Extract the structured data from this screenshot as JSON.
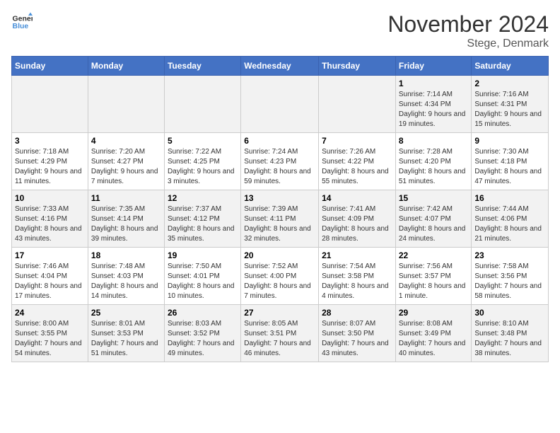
{
  "header": {
    "logo_line1": "General",
    "logo_line2": "Blue",
    "month": "November 2024",
    "location": "Stege, Denmark"
  },
  "weekdays": [
    "Sunday",
    "Monday",
    "Tuesday",
    "Wednesday",
    "Thursday",
    "Friday",
    "Saturday"
  ],
  "weeks": [
    [
      {
        "day": "",
        "info": ""
      },
      {
        "day": "",
        "info": ""
      },
      {
        "day": "",
        "info": ""
      },
      {
        "day": "",
        "info": ""
      },
      {
        "day": "",
        "info": ""
      },
      {
        "day": "1",
        "info": "Sunrise: 7:14 AM\nSunset: 4:34 PM\nDaylight: 9 hours and 19 minutes."
      },
      {
        "day": "2",
        "info": "Sunrise: 7:16 AM\nSunset: 4:31 PM\nDaylight: 9 hours and 15 minutes."
      }
    ],
    [
      {
        "day": "3",
        "info": "Sunrise: 7:18 AM\nSunset: 4:29 PM\nDaylight: 9 hours and 11 minutes."
      },
      {
        "day": "4",
        "info": "Sunrise: 7:20 AM\nSunset: 4:27 PM\nDaylight: 9 hours and 7 minutes."
      },
      {
        "day": "5",
        "info": "Sunrise: 7:22 AM\nSunset: 4:25 PM\nDaylight: 9 hours and 3 minutes."
      },
      {
        "day": "6",
        "info": "Sunrise: 7:24 AM\nSunset: 4:23 PM\nDaylight: 8 hours and 59 minutes."
      },
      {
        "day": "7",
        "info": "Sunrise: 7:26 AM\nSunset: 4:22 PM\nDaylight: 8 hours and 55 minutes."
      },
      {
        "day": "8",
        "info": "Sunrise: 7:28 AM\nSunset: 4:20 PM\nDaylight: 8 hours and 51 minutes."
      },
      {
        "day": "9",
        "info": "Sunrise: 7:30 AM\nSunset: 4:18 PM\nDaylight: 8 hours and 47 minutes."
      }
    ],
    [
      {
        "day": "10",
        "info": "Sunrise: 7:33 AM\nSunset: 4:16 PM\nDaylight: 8 hours and 43 minutes."
      },
      {
        "day": "11",
        "info": "Sunrise: 7:35 AM\nSunset: 4:14 PM\nDaylight: 8 hours and 39 minutes."
      },
      {
        "day": "12",
        "info": "Sunrise: 7:37 AM\nSunset: 4:12 PM\nDaylight: 8 hours and 35 minutes."
      },
      {
        "day": "13",
        "info": "Sunrise: 7:39 AM\nSunset: 4:11 PM\nDaylight: 8 hours and 32 minutes."
      },
      {
        "day": "14",
        "info": "Sunrise: 7:41 AM\nSunset: 4:09 PM\nDaylight: 8 hours and 28 minutes."
      },
      {
        "day": "15",
        "info": "Sunrise: 7:42 AM\nSunset: 4:07 PM\nDaylight: 8 hours and 24 minutes."
      },
      {
        "day": "16",
        "info": "Sunrise: 7:44 AM\nSunset: 4:06 PM\nDaylight: 8 hours and 21 minutes."
      }
    ],
    [
      {
        "day": "17",
        "info": "Sunrise: 7:46 AM\nSunset: 4:04 PM\nDaylight: 8 hours and 17 minutes."
      },
      {
        "day": "18",
        "info": "Sunrise: 7:48 AM\nSunset: 4:03 PM\nDaylight: 8 hours and 14 minutes."
      },
      {
        "day": "19",
        "info": "Sunrise: 7:50 AM\nSunset: 4:01 PM\nDaylight: 8 hours and 10 minutes."
      },
      {
        "day": "20",
        "info": "Sunrise: 7:52 AM\nSunset: 4:00 PM\nDaylight: 8 hours and 7 minutes."
      },
      {
        "day": "21",
        "info": "Sunrise: 7:54 AM\nSunset: 3:58 PM\nDaylight: 8 hours and 4 minutes."
      },
      {
        "day": "22",
        "info": "Sunrise: 7:56 AM\nSunset: 3:57 PM\nDaylight: 8 hours and 1 minute."
      },
      {
        "day": "23",
        "info": "Sunrise: 7:58 AM\nSunset: 3:56 PM\nDaylight: 7 hours and 58 minutes."
      }
    ],
    [
      {
        "day": "24",
        "info": "Sunrise: 8:00 AM\nSunset: 3:55 PM\nDaylight: 7 hours and 54 minutes."
      },
      {
        "day": "25",
        "info": "Sunrise: 8:01 AM\nSunset: 3:53 PM\nDaylight: 7 hours and 51 minutes."
      },
      {
        "day": "26",
        "info": "Sunrise: 8:03 AM\nSunset: 3:52 PM\nDaylight: 7 hours and 49 minutes."
      },
      {
        "day": "27",
        "info": "Sunrise: 8:05 AM\nSunset: 3:51 PM\nDaylight: 7 hours and 46 minutes."
      },
      {
        "day": "28",
        "info": "Sunrise: 8:07 AM\nSunset: 3:50 PM\nDaylight: 7 hours and 43 minutes."
      },
      {
        "day": "29",
        "info": "Sunrise: 8:08 AM\nSunset: 3:49 PM\nDaylight: 7 hours and 40 minutes."
      },
      {
        "day": "30",
        "info": "Sunrise: 8:10 AM\nSunset: 3:48 PM\nDaylight: 7 hours and 38 minutes."
      }
    ]
  ]
}
